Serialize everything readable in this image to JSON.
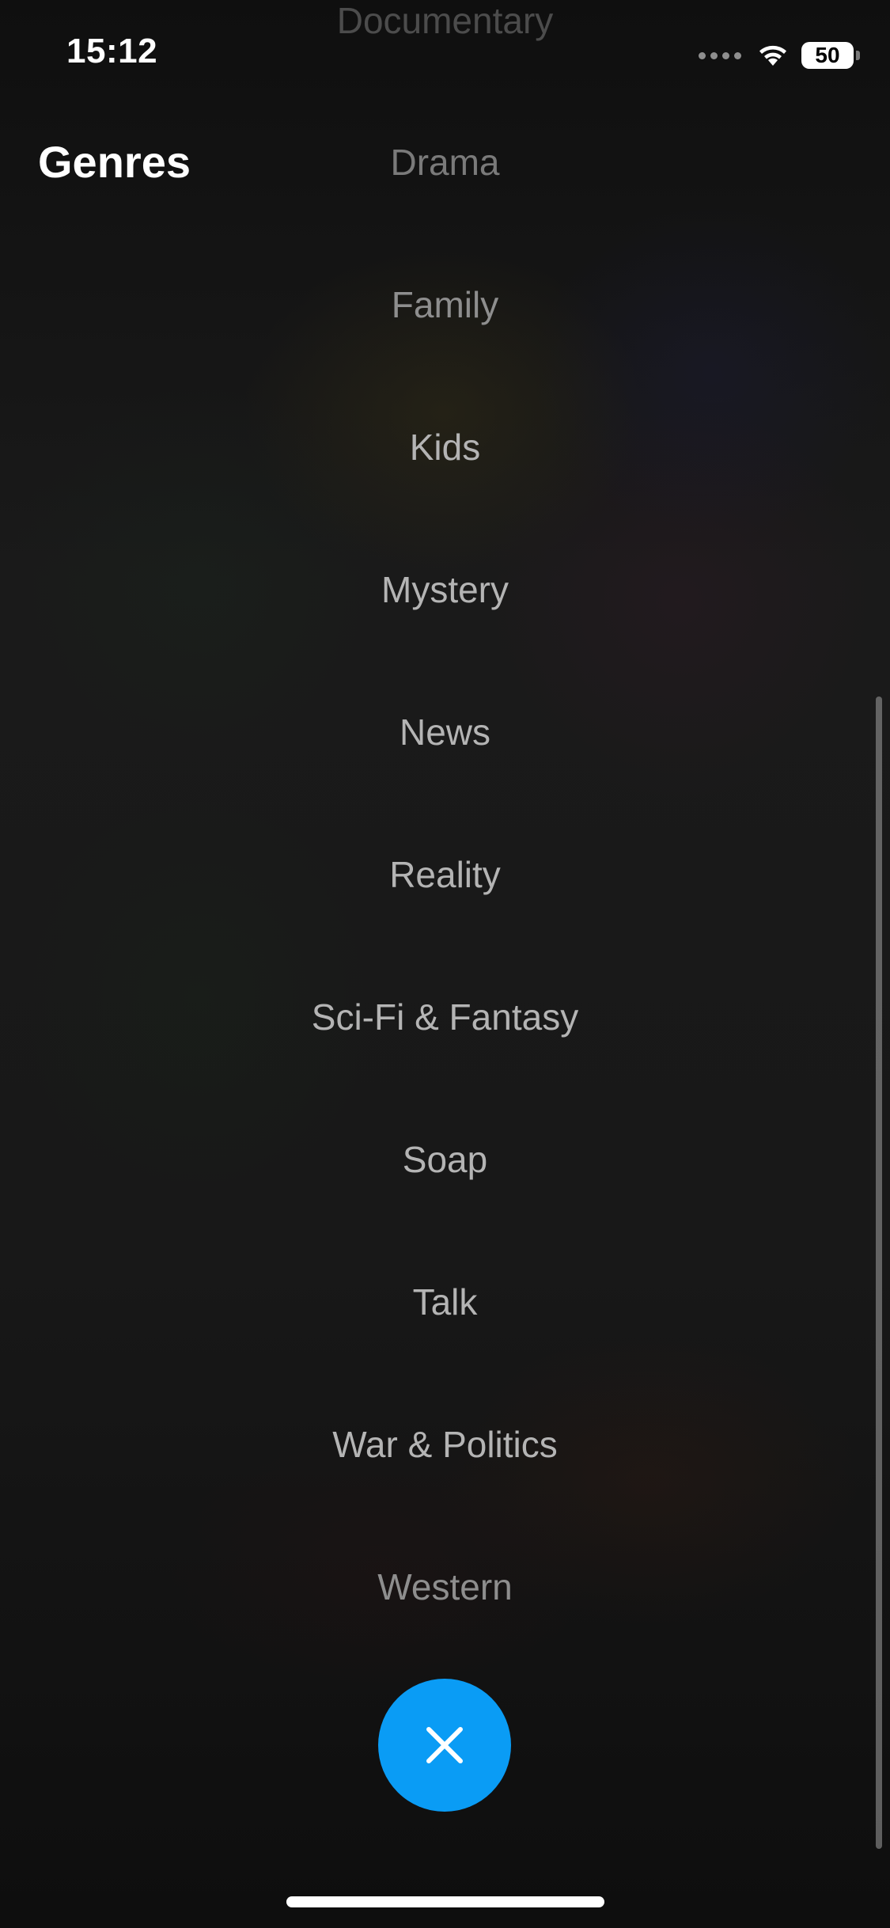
{
  "status_bar": {
    "time": "15:12",
    "battery_level": "50",
    "icons": [
      "signal-dots-icon",
      "wifi-icon",
      "battery-icon"
    ]
  },
  "header": {
    "title": "Genres"
  },
  "genres": [
    "Documentary",
    "Drama",
    "Family",
    "Kids",
    "Mystery",
    "News",
    "Reality",
    "Sci-Fi & Fantasy",
    "Soap",
    "Talk",
    "War & Politics",
    "Western"
  ],
  "close_button": {
    "icon": "close-icon"
  },
  "colors": {
    "accent": "#0a9cf5",
    "background": "#121212",
    "item_text": "#b4b4b4"
  }
}
